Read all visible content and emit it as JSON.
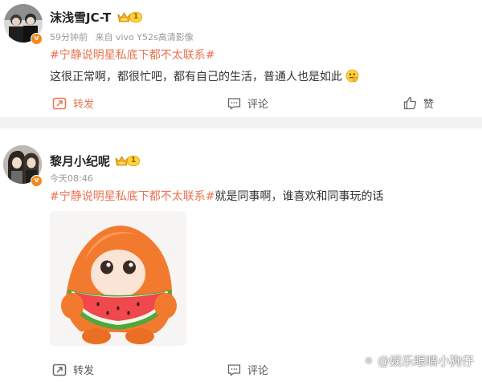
{
  "posts": [
    {
      "username": "沫浅雪JC-T",
      "level": "1",
      "verified_mark": "v",
      "time": "59分钟前",
      "source": "来自 vivo Y52s高清影像",
      "topic": "#宁静说明星私底下都不太联系#",
      "text": "这很正常啊，都很忙吧，都有自己的生活，普通人也是如此",
      "emoji_icon": "thinking-face-icon",
      "actions": {
        "repost": "转发",
        "comment": "评论",
        "like": "赞"
      }
    },
    {
      "username": "黎月小纪呢",
      "level": "1",
      "verified_mark": "v",
      "time": "今天08:46",
      "topic": "#宁静说明星私底下都不太联系#",
      "text": "就是同事啊，谁喜欢和同事玩的话",
      "sticker_icon": "watermelon-character-sticker",
      "actions": {
        "repost": "转发",
        "comment": "评论"
      }
    }
  ],
  "watermark": {
    "text": "@娱乐眼睛小狗仔"
  },
  "colors": {
    "topic": "#eb7350",
    "meta": "#999999",
    "divider": "#f2f2f2",
    "verified_badge": "#f08a1c"
  }
}
